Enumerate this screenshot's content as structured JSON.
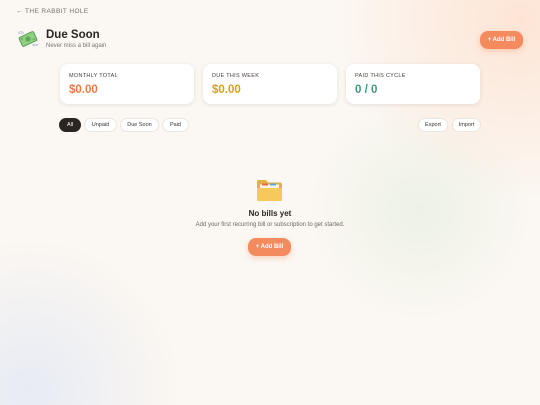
{
  "nav": {
    "back_label": "← THE RABBIT HOLE"
  },
  "header": {
    "icon": "money-with-wings-icon",
    "title": "Due Soon",
    "subtitle": "Never miss a bill again",
    "add_button_label": "+ Add Bill"
  },
  "stats": [
    {
      "label": "MONTHLY TOTAL",
      "value": "$0.00",
      "color": "#ee7a3f"
    },
    {
      "label": "DUE THIS WEEK",
      "value": "$0.00",
      "color": "#d6a21e"
    },
    {
      "label": "PAID THIS CYCLE",
      "value": "0 / 0",
      "color": "#3f9a76"
    }
  ],
  "filters": {
    "items": [
      "All",
      "Unpaid",
      "Due Soon",
      "Paid"
    ],
    "active": "All",
    "export_label": "Export",
    "import_label": "Import"
  },
  "empty_state": {
    "icon": "folder-icon",
    "title": "No bills yet",
    "description": "Add your first recurring bill or subscription to get started.",
    "button_label": "+ Add Bill"
  },
  "colors": {
    "accent": "#f48b5e",
    "background": "#fbf7f2",
    "active_pill": "#2a2522"
  }
}
